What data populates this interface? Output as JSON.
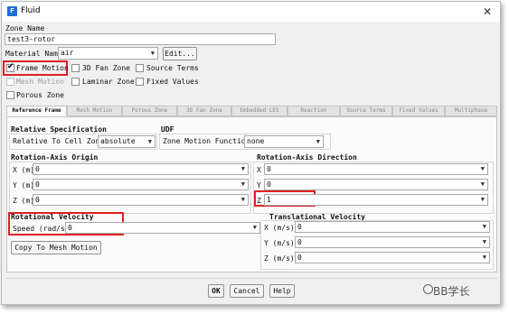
{
  "window": {
    "title": "Fluid",
    "icon_letter": "F"
  },
  "zone_name": {
    "label": "Zone Name",
    "value": "test3-rotor"
  },
  "material": {
    "label": "Material Name",
    "value": "air",
    "edit_label": "Edit..."
  },
  "checkboxes": {
    "frame_motion": {
      "label": "Frame Motion",
      "checked": true
    },
    "fan_zone": {
      "label": "3D Fan Zone",
      "checked": false
    },
    "source_terms": {
      "label": "Source Terms",
      "checked": false
    },
    "mesh_motion": {
      "label": "Mesh Motion",
      "checked": false
    },
    "laminar_zone": {
      "label": "Laminar Zone",
      "checked": false
    },
    "fixed_values": {
      "label": "Fixed Values",
      "checked": false
    },
    "porous_zone": {
      "label": "Porous Zone",
      "checked": false
    }
  },
  "tabs": [
    "Reference Frame",
    "Mesh Motion",
    "Porous Zone",
    "3D Fan Zone",
    "Embedded LES",
    "Reaction",
    "Source Terms",
    "Fixed Values",
    "Multiphase"
  ],
  "reference_frame": {
    "relative_spec": {
      "title": "Relative Specification",
      "label": "Relative To Cell Zone",
      "value": "absolute"
    },
    "udf": {
      "title": "UDF",
      "label": "Zone Motion Function",
      "value": "none"
    },
    "axis_origin": {
      "title": "Rotation-Axis Origin",
      "x": {
        "label": "X (m)",
        "value": "0"
      },
      "y": {
        "label": "Y (m)",
        "value": "0"
      },
      "z": {
        "label": "Z (m)",
        "value": "0"
      }
    },
    "axis_direction": {
      "title": "Rotation-Axis Direction",
      "x": {
        "label": "X",
        "value": "0"
      },
      "y": {
        "label": "Y",
        "value": "0"
      },
      "z": {
        "label": "Z",
        "value": "1"
      }
    },
    "rotational_velocity": {
      "title": "Rotational Velocity",
      "speed": {
        "label": "Speed (rad/s)",
        "value": "0"
      },
      "copy_label": "Copy To Mesh Motion"
    },
    "translational_velocity": {
      "title": "Translational Velocity",
      "x": {
        "label": "X (m/s)",
        "value": "0"
      },
      "y": {
        "label": "Y (m/s)",
        "value": "0"
      },
      "z": {
        "label": "Z (m/s)",
        "value": "0"
      }
    }
  },
  "buttons": {
    "ok": "OK",
    "cancel": "Cancel",
    "help": "Help"
  },
  "watermark": "BB学长",
  "colors": {
    "highlight": "#e02020",
    "icon": "#1e6fcf"
  }
}
